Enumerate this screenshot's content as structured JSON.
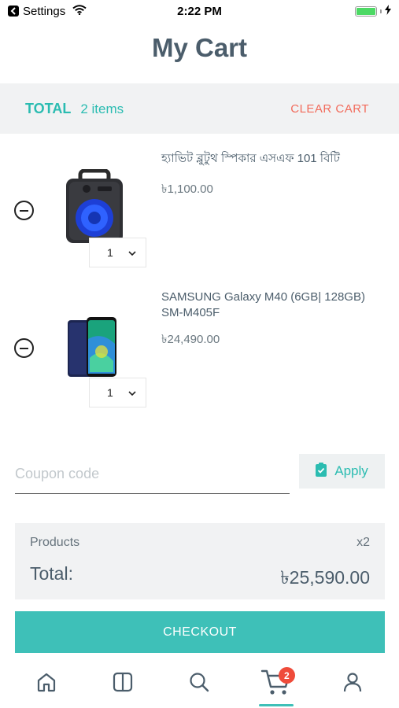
{
  "status_bar": {
    "back_app": "Settings",
    "time": "2:22 PM",
    "battery_level": 1.0
  },
  "page": {
    "title": "My Cart"
  },
  "cart_summary": {
    "total_label": "TOTAL",
    "item_count": "2 items",
    "clear_label": "CLEAR CART"
  },
  "items": [
    {
      "name": "হ্যাভিট ব্লুটুথ স্পিকার এসএফ 101 বিটি",
      "price": "৳1,100.00",
      "quantity": "1",
      "image": "bluetooth-speaker"
    },
    {
      "name": "SAMSUNG Galaxy M40 (6GB| 128GB) SM-M405F",
      "price": "৳24,490.00",
      "quantity": "1",
      "image": "samsung-phone"
    }
  ],
  "coupon": {
    "placeholder": "Coupon code",
    "apply_label": "Apply"
  },
  "summary": {
    "products_label": "Products",
    "products_count": "x2",
    "total_label": "Total:",
    "total_value": "৳25,590.00"
  },
  "checkout": {
    "label": "CHECKOUT"
  },
  "tab_bar": {
    "tabs": [
      "home-icon",
      "categories-icon",
      "search-icon",
      "cart-icon",
      "profile-icon"
    ],
    "active_tab": "cart-icon",
    "cart_badge": "2"
  },
  "colors": {
    "accent": "#3ec0b8",
    "clear_cart": "#f26b5b",
    "badge": "#ef4b3a"
  }
}
